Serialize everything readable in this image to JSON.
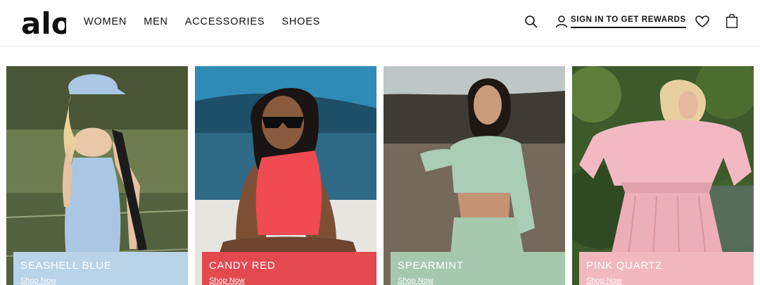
{
  "brand": {
    "logo_text": "alo"
  },
  "nav": {
    "items": [
      {
        "label": "WOMEN"
      },
      {
        "label": "MEN"
      },
      {
        "label": "ACCESSORIES"
      },
      {
        "label": "SHOES"
      }
    ]
  },
  "header_actions": {
    "search_icon": "search-icon",
    "signin_label": "SIGN IN TO GET REWARDS",
    "user_icon": "user-icon",
    "wishlist_icon": "heart-icon",
    "bag_icon": "shopping-bag-icon"
  },
  "products": [
    {
      "color_name": "SEASHELL BLUE",
      "cta": "Shop Now",
      "swatch": "#b9d3e8"
    },
    {
      "color_name": "CANDY RED",
      "cta": "Shop Now",
      "swatch": "#e4494f"
    },
    {
      "color_name": "SPEARMINT",
      "cta": "Shop Now",
      "swatch": "#a6c9ae"
    },
    {
      "color_name": "PINK QUARTZ",
      "cta": "Shop Now",
      "swatch": "#f1b8bf"
    }
  ]
}
